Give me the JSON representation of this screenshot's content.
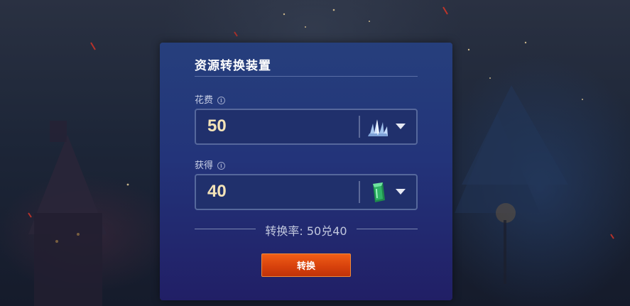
{
  "panel": {
    "title": "资源转换装置"
  },
  "cost": {
    "label": "花费",
    "value": "50",
    "resource_icon": "crystal-shards-icon"
  },
  "gain": {
    "label": "获得",
    "value": "40",
    "resource_icon": "green-gem-icon"
  },
  "rate": {
    "text": "转换率: 50兑40"
  },
  "convert_button": {
    "label": "转换"
  },
  "colors": {
    "accent_button": "#e14d10",
    "panel_top": "#263f7c",
    "panel_bottom": "#211f66",
    "value_text": "#f3e3b8"
  }
}
